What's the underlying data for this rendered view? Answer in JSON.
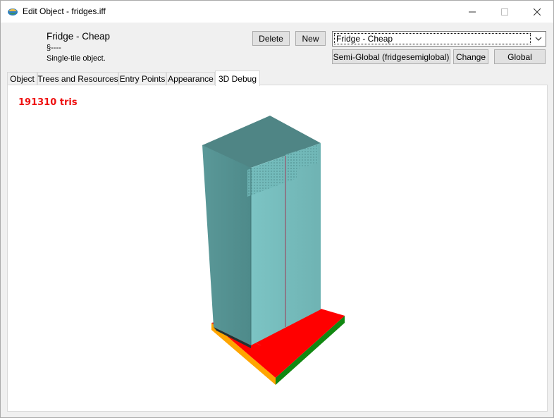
{
  "window": {
    "title": "Edit Object - fridges.iff"
  },
  "object": {
    "name": "Fridge - Cheap",
    "subtitle": "§----",
    "description": "Single-tile object."
  },
  "toolbar": {
    "delete_label": "Delete",
    "new_label": "New",
    "selector_value": "Fridge - Cheap",
    "semi_global_label": "Semi-Global (fridgesemiglobal)",
    "change_label": "Change",
    "global_label": "Global"
  },
  "tabs": [
    {
      "label": "Object",
      "active": false
    },
    {
      "label": "Trees and Resources",
      "active": false
    },
    {
      "label": "Entry Points",
      "active": false
    },
    {
      "label": "Appearance",
      "active": false
    },
    {
      "label": "3D Debug",
      "active": true
    }
  ],
  "debug": {
    "triangle_count": "191310 tris"
  },
  "colors": {
    "tris_text": "#ee1111",
    "fridge_body": "#6fb3b3",
    "floor_top": "#ff0000",
    "floor_left_edge": "#ffa500",
    "floor_right_edge": "#118811"
  }
}
